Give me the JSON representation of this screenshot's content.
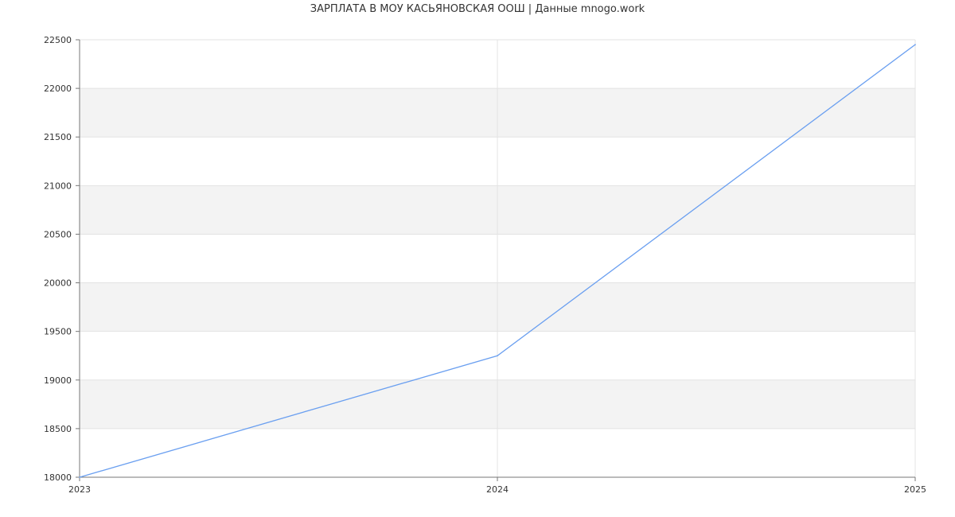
{
  "chart_data": {
    "type": "line",
    "title": "ЗАРПЛАТА В МОУ КАСЬЯНОВСКАЯ ООШ | Данные mnogo.work",
    "xlabel": "",
    "ylabel": "",
    "x": [
      "2023",
      "2024",
      "2025"
    ],
    "series": [
      {
        "values": [
          18000,
          19250,
          22450
        ],
        "color": "#6a9ff0"
      }
    ],
    "ylim": [
      18000,
      22500
    ],
    "yticks": [
      18000,
      18500,
      19000,
      19500,
      20000,
      20500,
      21000,
      21500,
      22000,
      22500
    ],
    "grid": true,
    "band_color": "#f3f3f3",
    "grid_color": "#e3e3e3",
    "axis_color": "#777777"
  }
}
